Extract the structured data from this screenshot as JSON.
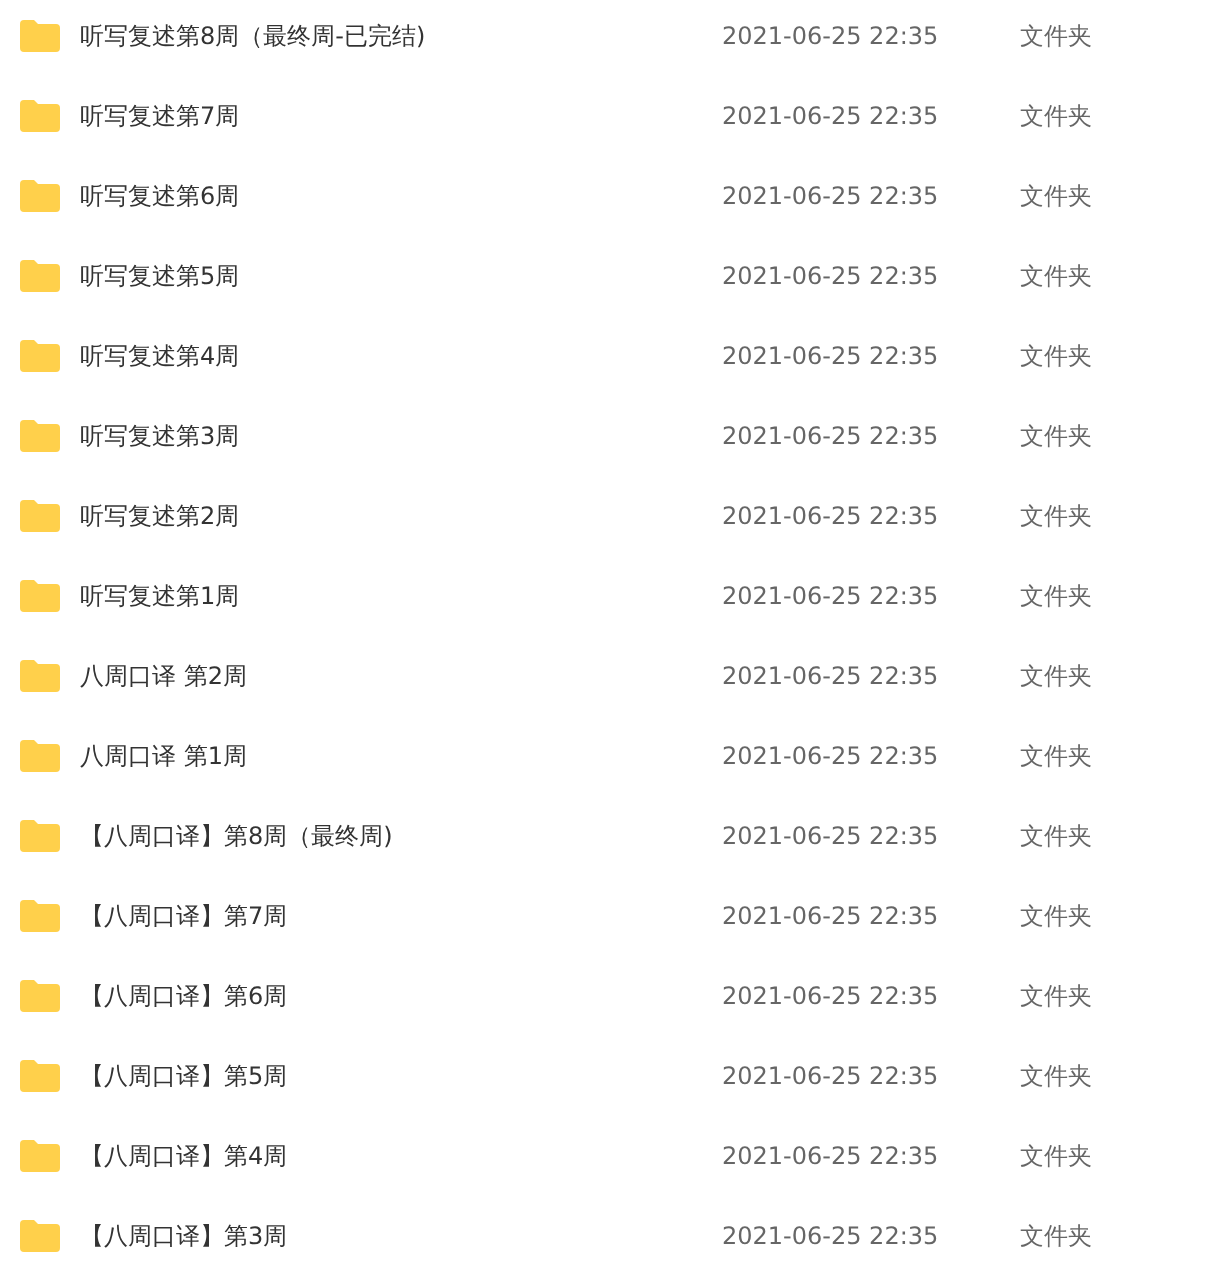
{
  "files": [
    {
      "name": "听写复述第8周（最终周-已完结)",
      "modified": "2021-06-25 22:35",
      "type": "文件夹"
    },
    {
      "name": "听写复述第7周",
      "modified": "2021-06-25 22:35",
      "type": "文件夹"
    },
    {
      "name": "听写复述第6周",
      "modified": "2021-06-25 22:35",
      "type": "文件夹"
    },
    {
      "name": "听写复述第5周",
      "modified": "2021-06-25 22:35",
      "type": "文件夹"
    },
    {
      "name": "听写复述第4周",
      "modified": "2021-06-25 22:35",
      "type": "文件夹"
    },
    {
      "name": "听写复述第3周",
      "modified": "2021-06-25 22:35",
      "type": "文件夹"
    },
    {
      "name": "听写复述第2周",
      "modified": "2021-06-25 22:35",
      "type": "文件夹"
    },
    {
      "name": "听写复述第1周",
      "modified": "2021-06-25 22:35",
      "type": "文件夹"
    },
    {
      "name": "八周口译 第2周",
      "modified": "2021-06-25 22:35",
      "type": "文件夹"
    },
    {
      "name": "八周口译 第1周",
      "modified": "2021-06-25 22:35",
      "type": "文件夹"
    },
    {
      "name": "【八周口译】第8周（最终周)",
      "modified": "2021-06-25 22:35",
      "type": "文件夹"
    },
    {
      "name": "【八周口译】第7周",
      "modified": "2021-06-25 22:35",
      "type": "文件夹"
    },
    {
      "name": "【八周口译】第6周",
      "modified": "2021-06-25 22:35",
      "type": "文件夹"
    },
    {
      "name": "【八周口译】第5周",
      "modified": "2021-06-25 22:35",
      "type": "文件夹"
    },
    {
      "name": "【八周口译】第4周",
      "modified": "2021-06-25 22:35",
      "type": "文件夹"
    },
    {
      "name": "【八周口译】第3周",
      "modified": "2021-06-25 22:35",
      "type": "文件夹"
    }
  ]
}
